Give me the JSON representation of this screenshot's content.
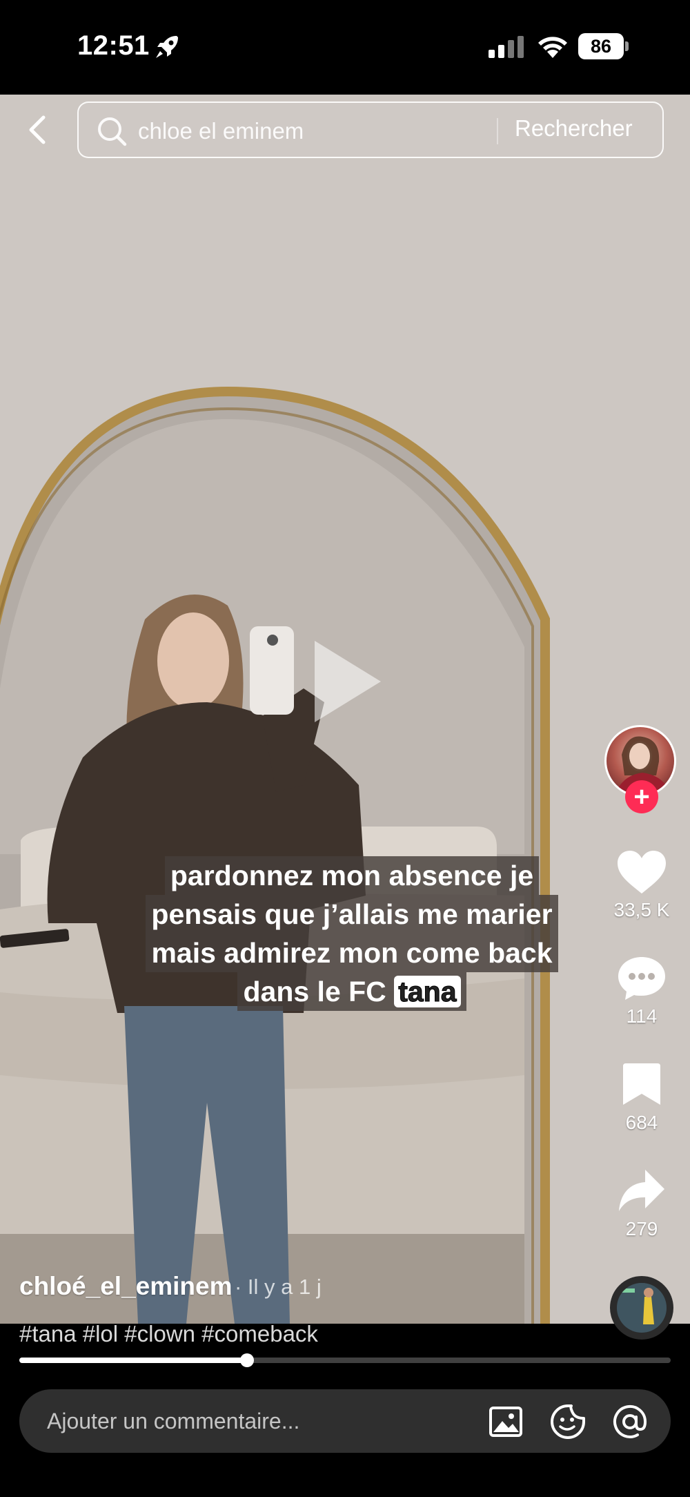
{
  "status_bar": {
    "time": "12:51",
    "battery": "86"
  },
  "header": {
    "search_value": "chloe el eminem",
    "search_button": "Rechercher"
  },
  "caption": {
    "lines": [
      "pardonnez mon absence je",
      "pensais que j’allais me marier",
      "mais admirez mon come back",
      "dans le FC"
    ],
    "tag": "tana"
  },
  "rail": {
    "likes": "33,5 K",
    "comments": "114",
    "saves": "684",
    "shares": "279"
  },
  "post": {
    "author": "chloé_el_eminem",
    "time": "· Il y a 1 j",
    "hashtags": "#tana #lol #clown #comeback",
    "progress": 0.35
  },
  "comment_bar": {
    "placeholder": "Ajouter un commentaire..."
  },
  "colors": {
    "accent": "#fe2c55",
    "mirror_frame": "#b08d4a"
  }
}
